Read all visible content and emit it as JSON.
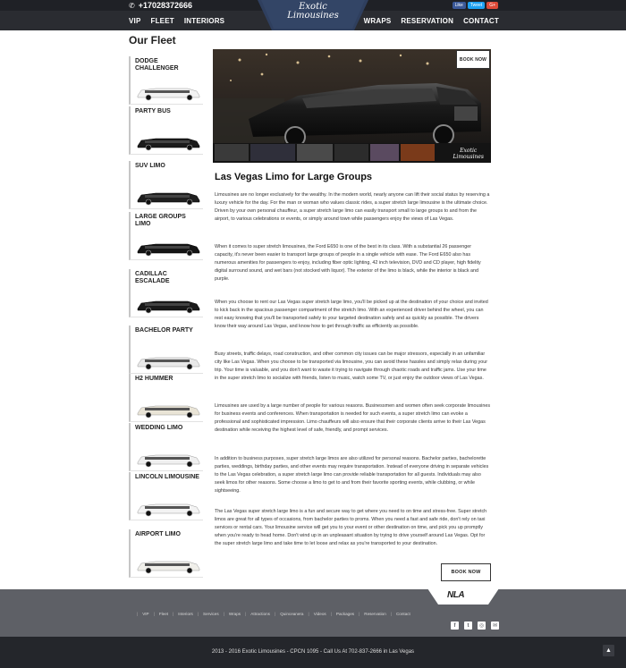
{
  "header": {
    "phone": "+17028372666",
    "phone_icon": "phone-icon",
    "social": [
      "Like",
      "Tweet",
      "G+"
    ],
    "social_colors": [
      "#3b5998",
      "#1da1f2",
      "#dd4b39"
    ],
    "logo_line1": "Exotic",
    "logo_line2": "Limousines",
    "nav_left": [
      "VIP",
      "FLEET",
      "INTERIORS"
    ],
    "nav_right": [
      "WRAPS",
      "RESERVATION",
      "CONTACT"
    ]
  },
  "page_title": "Our Fleet",
  "fleet": [
    {
      "label": "DODGE CHALLENGER",
      "color": "#f2f2f2"
    },
    {
      "label": "PARTY BUS",
      "color": "#1b1b1b"
    },
    {
      "label": "SUV LIMO",
      "color": "#1f1f1f"
    },
    {
      "label": "LARGE GROUPS LIMO",
      "color": "#151515"
    },
    {
      "label": "CADILLAC ESCALADE",
      "color": "#1a1a1a"
    },
    {
      "label": "BACHELOR PARTY",
      "color": "#e8e8e8"
    },
    {
      "label": "H2 HUMMER",
      "color": "#e9e4d6"
    },
    {
      "label": "WEDDING LIMO",
      "color": "#efefef"
    },
    {
      "label": "LINCOLN LIMOUSINE",
      "color": "#f3f3f3"
    },
    {
      "label": "AIRPORT LIMO",
      "color": "#f0efea"
    }
  ],
  "hero": {
    "book_label": "BOOK NOW",
    "watermark_line1": "Exotic",
    "watermark_line2": "Limousines"
  },
  "article": {
    "title": "Las Vegas Limo for Large Groups",
    "paragraphs": [
      "Limousines are no longer exclusively for the wealthy. In the modern world, nearly anyone can lift their social status by reserving a luxury vehicle for the day. For the man or woman who values classic rides, a super stretch large limousine is the ultimate choice. Driven by your own personal chauffeur, a super stretch large limo can easily transport small to large groups to and from the airport, to various celebrations or events, or simply around town while passengers enjoy the views of Las Vegas.",
      "When it comes to super stretch limousines, the Ford E650 is one of the best in its class. With a substantial 26 passenger capacity, it's never been easier to transport large groups of people in a single vehicle with ease. The Ford E650 also has numerous amenities for passengers to enjoy, including fiber optic lighting, 42 inch television, DVD and CD player, high fidelity digital surround sound, and wet bars (not stocked with liquor). The exterior of the limo is black, while the interior is black and purple.",
      "When you choose to rent our Las Vegas super stretch large limo, you'll be picked up at the destination of your choice and invited to kick back in the spacious passenger compartment of the stretch limo. With an experienced driver behind the wheel, you can rest easy knowing that you'll be transported safely to your targeted destination safely and as quickly as possible. The drivers know their way around Las Vegas, and know how to get through traffic as efficiently as possible.",
      "Busy streets, traffic delays, road construction, and other common city issues can be major stressors, especially in an unfamiliar city like Las Vegas. When you choose to be transported via limousine, you can avoid these hassles and simply relax during your trip. Your time is valuable, and you don't want to waste it trying to navigate through chaotic roads and traffic jams. Use your time in the super stretch limo to socialize with friends, listen to music, watch some TV, or just enjoy the outdoor views of Las Vegas.",
      "Limousines are used by a large number of people for various reasons. Businessmen and women often seek corporate limousines for business events and conferences. When transportation is needed for such events, a super stretch limo can evoke a professional and sophisticated impression. Limo chauffeurs will also ensure that their corporate clients arrive to their Las Vegas destination while receiving the highest level of safe, friendly, and prompt services.",
      "In addition to business purposes, super stretch large limos are also utilized for personal reasons. Bachelor parties, bachelorette parties, weddings, birthday parties, and other events may require transportation. Instead of everyone driving in separate vehicles to the Las Vegas celebration, a super stretch large limo can provide reliable transportation for all guests. Individuals may also seek limos for other reasons. Some choose a limo to get to and from their favorite sporting events, while clubbing, or while sightseeing.",
      "The Las Vegas super stretch large limo is a fun and secure way to get where you need to on time and stress-free. Super stretch limos are great for all types of occasions, from bachelor parties to proms. When you need a fast and safe ride, don't rely on taxi services or rental cars. Your limousine service will get you to your event or other destination on time, and pick you up promptly when you're ready to head home. Don't wind up in an unpleasant situation by trying to drive yourself around Las Vegas. Opt for the super stretch large limo and take time to let loose and relax as you're transported to your destination."
    ],
    "book_label": "BOOK NOW"
  },
  "footer": {
    "badge": "NLA",
    "links": [
      "VIP",
      "Fleet",
      "Interiors",
      "Services",
      "Wraps",
      "Attractions",
      "Quinceanera",
      "Videos",
      "Packages",
      "Reservation",
      "Contact"
    ],
    "social": [
      "facebook-icon",
      "twitter-icon",
      "instagram-icon",
      "email-icon"
    ],
    "social_glyphs": [
      "f",
      "t",
      "◎",
      "✉"
    ],
    "copyright": "2013 - 2016 Exotic Limousines - CPCN 1095 - Call Us At 702-837-2666 in Las Vegas",
    "to_top": "▲"
  }
}
